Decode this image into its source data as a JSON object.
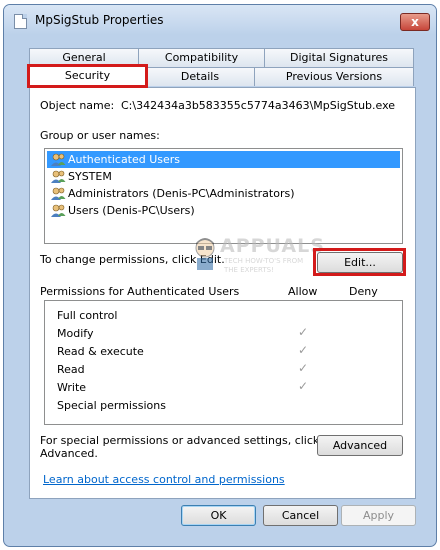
{
  "window": {
    "title": "MpSigStub Properties",
    "close_label": "x"
  },
  "tabs": {
    "row1": [
      "General",
      "Compatibility",
      "Digital Signatures"
    ],
    "row2": [
      "Security",
      "Details",
      "Previous Versions"
    ]
  },
  "security": {
    "object_name_label": "Object name:",
    "object_name_value": "C:\\342434a3b583355c5774a3463\\MpSigStub.exe",
    "group_label": "Group or user names:",
    "users": [
      "Authenticated Users",
      "SYSTEM",
      "Administrators (Denis-PC\\Administrators)",
      "Users (Denis-PC\\Users)"
    ],
    "change_text": "To change permissions, click Edit.",
    "edit_label": "Edit...",
    "permissions_header": "Permissions for Authenticated Users",
    "allow_label": "Allow",
    "deny_label": "Deny",
    "permissions": [
      {
        "name": "Full control",
        "allow": false,
        "deny": false
      },
      {
        "name": "Modify",
        "allow": true,
        "deny": false
      },
      {
        "name": "Read & execute",
        "allow": true,
        "deny": false
      },
      {
        "name": "Read",
        "allow": true,
        "deny": false
      },
      {
        "name": "Write",
        "allow": true,
        "deny": false
      },
      {
        "name": "Special permissions",
        "allow": false,
        "deny": false
      }
    ],
    "special_text_1": "For special permissions or advanced settings, click",
    "special_text_2": "Advanced.",
    "advanced_label": "Advanced",
    "learn_link": "Learn about access control and permissions"
  },
  "buttons": {
    "ok": "OK",
    "cancel": "Cancel",
    "apply": "Apply"
  },
  "watermark": {
    "brand": "APPUALS",
    "tagline_1": "TECH HOW-TO'S FROM",
    "tagline_2": "THE EXPERTS!"
  },
  "check_glyph": "✓",
  "colors": {
    "highlight": "#d31a1a",
    "selection": "#3399ff",
    "link": "#0066cc",
    "frame": "#bcd1ea"
  },
  "icons": {
    "app": "document-icon",
    "user": "users-icon"
  }
}
